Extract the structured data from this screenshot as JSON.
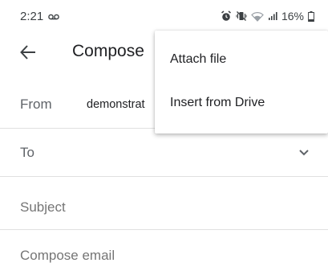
{
  "status_bar": {
    "time": "2:21",
    "battery_percent": "16%",
    "icons": [
      "voicemail-icon",
      "alarm-icon",
      "vibrate-icon",
      "wifi-icon",
      "signal-icon",
      "battery-icon"
    ]
  },
  "app_bar": {
    "title": "Compose",
    "back_icon": "arrow-back-icon"
  },
  "form": {
    "from_label": "From",
    "from_value": "demonstrat",
    "to_label": "To",
    "subject_placeholder": "Subject",
    "body_placeholder": "Compose email"
  },
  "menu": {
    "items": [
      {
        "label": "Attach file"
      },
      {
        "label": "Insert from Drive"
      }
    ]
  },
  "colors": {
    "text_primary": "#202124",
    "text_secondary": "#5f6368",
    "divider": "#e0e0e0"
  }
}
